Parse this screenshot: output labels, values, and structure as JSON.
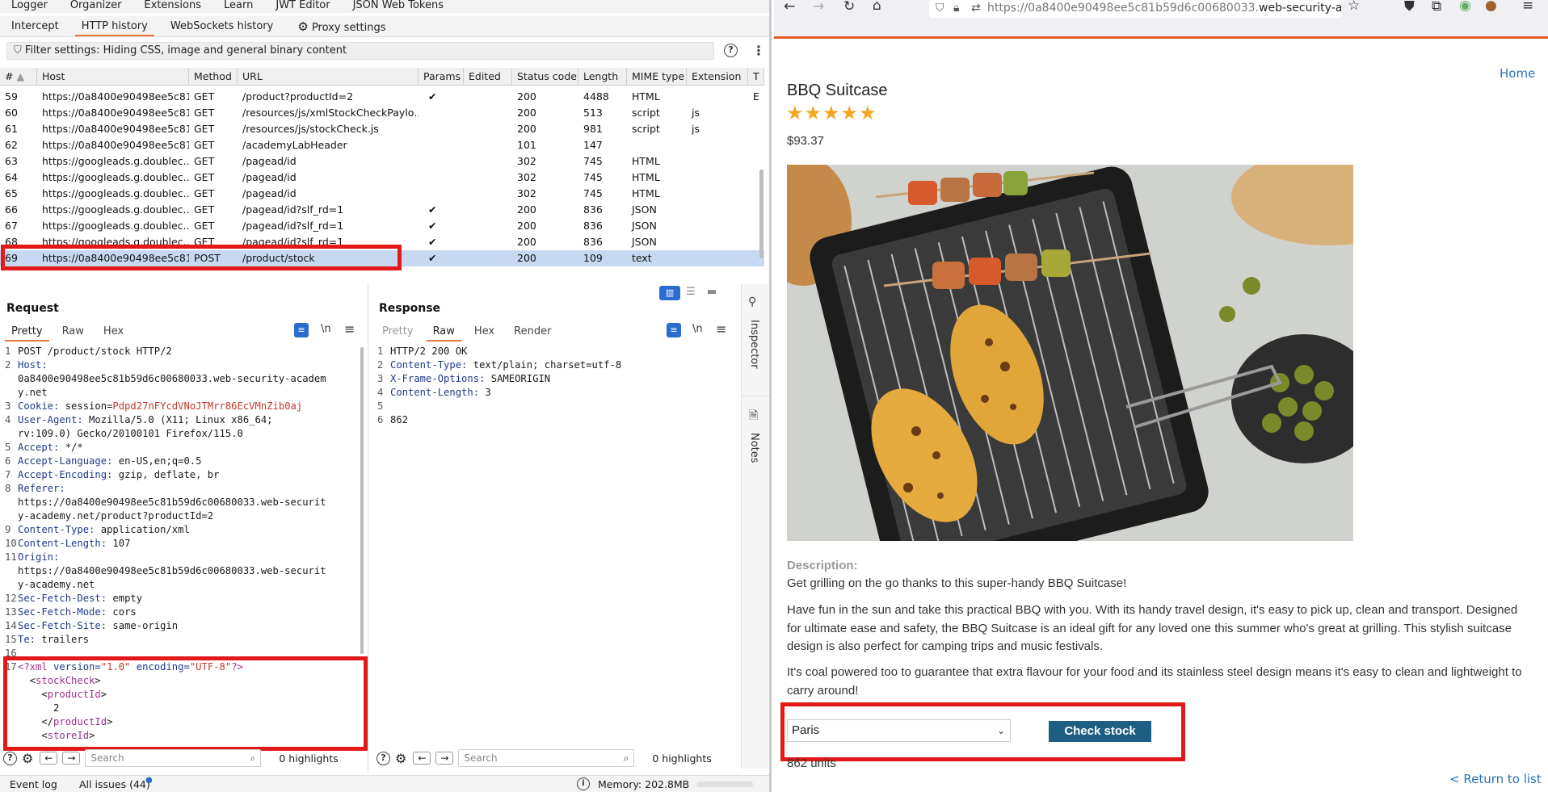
{
  "burp": {
    "top_menu": [
      "Logger",
      "Organizer",
      "Extensions",
      "Learn",
      "JWT Editor",
      "JSON Web Tokens"
    ],
    "sub_tabs": [
      "Intercept",
      "HTTP history",
      "WebSockets history",
      "Proxy settings"
    ],
    "filter_text": "Filter settings: Hiding CSS, image and general binary content",
    "table": {
      "headers": [
        "#",
        "Host",
        "Method",
        "URL",
        "Params",
        "Edited",
        "Status code",
        "Length",
        "MIME type",
        "Extension",
        "T"
      ],
      "rows": [
        {
          "num": "59",
          "host": "https://0a8400e90498ee5c81...",
          "method": "GET",
          "url": "/product?productId=2",
          "params": "✔",
          "edited": "",
          "status": "200",
          "length": "4488",
          "mime": "HTML",
          "ext": "",
          "t": "E"
        },
        {
          "num": "60",
          "host": "https://0a8400e90498ee5c81...",
          "method": "GET",
          "url": "/resources/js/xmlStockCheckPaylo...",
          "params": "",
          "edited": "",
          "status": "200",
          "length": "513",
          "mime": "script",
          "ext": "js",
          "t": ""
        },
        {
          "num": "61",
          "host": "https://0a8400e90498ee5c81...",
          "method": "GET",
          "url": "/resources/js/stockCheck.js",
          "params": "",
          "edited": "",
          "status": "200",
          "length": "981",
          "mime": "script",
          "ext": "js",
          "t": ""
        },
        {
          "num": "62",
          "host": "https://0a8400e90498ee5c81...",
          "method": "GET",
          "url": "/academyLabHeader",
          "params": "",
          "edited": "",
          "status": "101",
          "length": "147",
          "mime": "",
          "ext": "",
          "t": ""
        },
        {
          "num": "63",
          "host": "https://googleads.g.doublec...",
          "method": "GET",
          "url": "/pagead/id",
          "params": "",
          "edited": "",
          "status": "302",
          "length": "745",
          "mime": "HTML",
          "ext": "",
          "t": ""
        },
        {
          "num": "64",
          "host": "https://googleads.g.doublec...",
          "method": "GET",
          "url": "/pagead/id",
          "params": "",
          "edited": "",
          "status": "302",
          "length": "745",
          "mime": "HTML",
          "ext": "",
          "t": ""
        },
        {
          "num": "65",
          "host": "https://googleads.g.doublec...",
          "method": "GET",
          "url": "/pagead/id",
          "params": "",
          "edited": "",
          "status": "302",
          "length": "745",
          "mime": "HTML",
          "ext": "",
          "t": ""
        },
        {
          "num": "66",
          "host": "https://googleads.g.doublec...",
          "method": "GET",
          "url": "/pagead/id?slf_rd=1",
          "params": "✔",
          "edited": "",
          "status": "200",
          "length": "836",
          "mime": "JSON",
          "ext": "",
          "t": ""
        },
        {
          "num": "67",
          "host": "https://googleads.g.doublec...",
          "method": "GET",
          "url": "/pagead/id?slf_rd=1",
          "params": "✔",
          "edited": "",
          "status": "200",
          "length": "836",
          "mime": "JSON",
          "ext": "",
          "t": ""
        },
        {
          "num": "68",
          "host": "https://googleads.g.doublec...",
          "method": "GET",
          "url": "/pagead/id?slf_rd=1",
          "params": "✔",
          "edited": "",
          "status": "200",
          "length": "836",
          "mime": "JSON",
          "ext": "",
          "t": ""
        },
        {
          "num": "69",
          "host": "https://0a8400e90498ee5c81...",
          "method": "POST",
          "url": "/product/stock",
          "params": "✔",
          "edited": "",
          "status": "200",
          "length": "109",
          "mime": "text",
          "ext": "",
          "t": "",
          "selected": true
        }
      ]
    },
    "request": {
      "title": "Request",
      "tabs": [
        "Pretty",
        "Raw",
        "Hex"
      ],
      "lines": [
        {
          "n": "1",
          "k": "",
          "v": "POST /product/stock HTTP/2"
        },
        {
          "n": "2",
          "k": "Host:",
          "v": ""
        },
        {
          "n": "",
          "k": "",
          "v": "0a8400e90498ee5c81b59d6c00680033.web-security-academ"
        },
        {
          "n": "",
          "k": "",
          "v": "y.net"
        },
        {
          "n": "3",
          "k": "Cookie:",
          "v": " session=",
          "red": "Pdpd27nFYcdVNoJTMrr86EcVMnZib0aj"
        },
        {
          "n": "4",
          "k": "User-Agent:",
          "v": " Mozilla/5.0 (X11; Linux x86_64;"
        },
        {
          "n": "",
          "k": "",
          "v": "rv:109.0) Gecko/20100101 Firefox/115.0"
        },
        {
          "n": "5",
          "k": "Accept:",
          "v": " */*"
        },
        {
          "n": "6",
          "k": "Accept-Language:",
          "v": " en-US,en;q=0.5"
        },
        {
          "n": "7",
          "k": "Accept-Encoding:",
          "v": " gzip, deflate, br"
        },
        {
          "n": "8",
          "k": "Referer:",
          "v": ""
        },
        {
          "n": "",
          "k": "",
          "v": "https://0a8400e90498ee5c81b59d6c00680033.web-securit"
        },
        {
          "n": "",
          "k": "",
          "v": "y-academy.net/product?productId=2"
        },
        {
          "n": "9",
          "k": "Content-Type:",
          "v": " application/xml"
        },
        {
          "n": "10",
          "k": "Content-Length:",
          "v": " 107"
        },
        {
          "n": "11",
          "k": "Origin:",
          "v": ""
        },
        {
          "n": "",
          "k": "",
          "v": "https://0a8400e90498ee5c81b59d6c00680033.web-securit"
        },
        {
          "n": "",
          "k": "",
          "v": "y-academy.net"
        },
        {
          "n": "12",
          "k": "Sec-Fetch-Dest:",
          "v": " empty"
        },
        {
          "n": "13",
          "k": "Sec-Fetch-Mode:",
          "v": " cors"
        },
        {
          "n": "14",
          "k": "Sec-Fetch-Site:",
          "v": " same-origin"
        },
        {
          "n": "15",
          "k": "Te:",
          "v": " trailers"
        },
        {
          "n": "16",
          "k": "",
          "v": ""
        }
      ],
      "xml_lines": [
        {
          "n": "17",
          "html": "<span class='xmltag'>&lt;?xml</span> <span class='hk'>version=</span><span class='red'>\"1.0\"</span> <span class='hk'>encoding=</span><span class='red'>\"UTF-8\"</span><span class='xmltag'>?&gt;</span>"
        },
        {
          "n": "",
          "html": "  &lt;<span class='xmltag'>stockCheck</span>&gt;"
        },
        {
          "n": "",
          "html": "    &lt;<span class='xmltag'>productId</span>&gt;"
        },
        {
          "n": "",
          "html": "      2"
        },
        {
          "n": "",
          "html": "    &lt;/<span class='xmltag'>productId</span>&gt;"
        },
        {
          "n": "",
          "html": "    &lt;<span class='xmltag'>storeId</span>&gt;"
        }
      ],
      "search_placeholder": "Search",
      "highlights": "0 highlights"
    },
    "response": {
      "title": "Response",
      "tabs": [
        "Pretty",
        "Raw",
        "Hex",
        "Render"
      ],
      "lines": [
        {
          "n": "1",
          "k": "",
          "v": "HTTP/2 200 OK"
        },
        {
          "n": "2",
          "k": "Content-Type:",
          "v": " text/plain; charset=utf-8"
        },
        {
          "n": "3",
          "k": "X-Frame-Options:",
          "v": " SAMEORIGIN"
        },
        {
          "n": "4",
          "k": "Content-Length:",
          "v": " 3"
        },
        {
          "n": "5",
          "k": "",
          "v": ""
        },
        {
          "n": "6",
          "k": "",
          "v": "862"
        }
      ],
      "search_placeholder": "Search",
      "highlights": "0 highlights"
    },
    "side_tabs": [
      "Inspector",
      "Notes"
    ],
    "status": {
      "event_log": "Event log",
      "all_issues": "All issues (44)",
      "memory": "Memory: 202.8MB"
    }
  },
  "browser": {
    "url_dim": "https://0a8400e90498ee5c81b59d6c00680033.",
    "url_main": "web-security-ac",
    "home_link": "Home",
    "product": {
      "name": "BBQ Suitcase",
      "stars": "★★★★★",
      "price": "$93.37",
      "desc_label": "Description:",
      "paragraphs": [
        "Get grilling on the go thanks to this super-handy BBQ Suitcase!",
        "Have fun in the sun and take this practical BBQ with you. With its handy travel design, it's easy to pick up, clean and transport. Designed for ultimate ease and safety, the BBQ Suitcase is an ideal gift for any loved one this summer who's great at grilling. This stylish suitcase design is also perfect for camping trips and music festivals.",
        "It's coal powered too to guarantee that extra flavour for your food and its stainless steel design means it's easy to clean and lightweight to carry around!"
      ],
      "store_selected": "Paris",
      "check_label": "Check stock",
      "stock_result": "862 units",
      "return_link": "< Return to list"
    }
  }
}
